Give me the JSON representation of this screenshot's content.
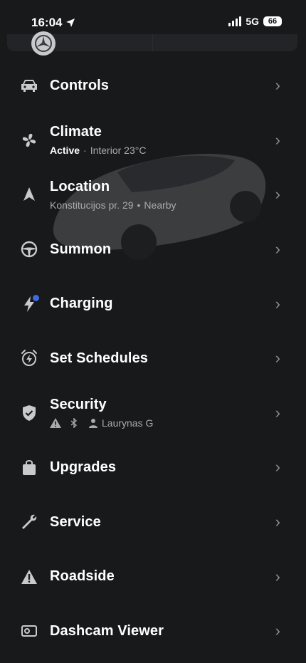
{
  "status_bar": {
    "time": "16:04",
    "network": "5G",
    "battery": "66"
  },
  "colors": {
    "background": "#18191b",
    "text": "#ffffff",
    "secondary_text": "#a9aaad",
    "icon": "#c9cacc",
    "chevron": "#8d8e91",
    "notification_dot": "#3e6ae1"
  },
  "menu": {
    "items": [
      {
        "label": "Controls",
        "icon": "car-icon"
      },
      {
        "label": "Climate",
        "icon": "fan-icon",
        "sub_status": "Active",
        "sub_sep": "·",
        "sub_text": "Interior 23°C"
      },
      {
        "label": "Location",
        "icon": "navigation-arrow-icon",
        "sub_text": "Konstitucijos pr. 29",
        "sub_sep": "•",
        "sub_extra": "Nearby"
      },
      {
        "label": "Summon",
        "icon": "steering-wheel-icon"
      },
      {
        "label": "Charging",
        "icon": "lightning-icon",
        "badge": "notification-dot"
      },
      {
        "label": "Set Schedules",
        "icon": "alarm-clock-icon"
      },
      {
        "label": "Security",
        "icon": "shield-icon",
        "sub_user": "Laurynas G"
      },
      {
        "label": "Upgrades",
        "icon": "shopping-bag-icon"
      },
      {
        "label": "Service",
        "icon": "wrench-icon"
      },
      {
        "label": "Roadside",
        "icon": "warning-triangle-icon"
      },
      {
        "label": "Dashcam Viewer",
        "icon": "dashcam-icon"
      }
    ]
  }
}
